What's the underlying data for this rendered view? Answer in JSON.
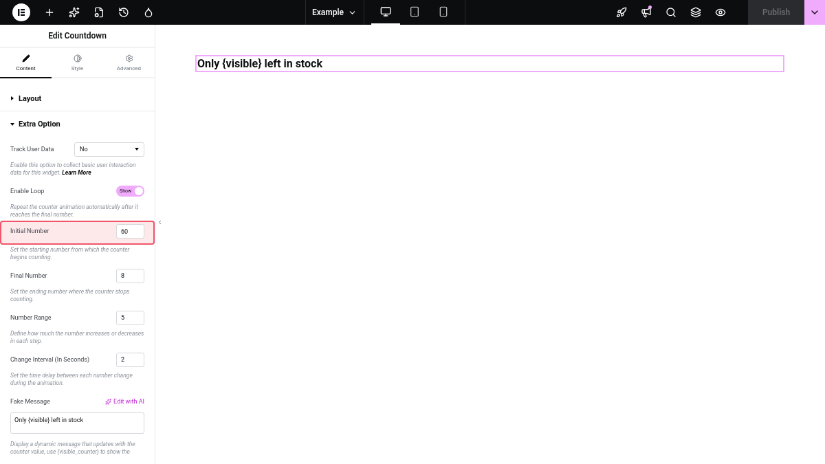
{
  "topbar": {
    "document": "Example",
    "devices": [
      {
        "kind": "desktop",
        "selected": true
      },
      {
        "kind": "tablet",
        "selected": false
      },
      {
        "kind": "mobile",
        "selected": false
      }
    ],
    "publish": {
      "label": "Publish",
      "disabled": true
    }
  },
  "panel": {
    "title": "Edit Countdown",
    "tabs": [
      {
        "label": "Content",
        "selected": true
      },
      {
        "label": "Style",
        "selected": false
      },
      {
        "label": "Advanced",
        "selected": false
      }
    ],
    "sections": [
      {
        "title": "Layout",
        "expanded": false
      },
      {
        "title": "Extra Option",
        "expanded": true
      }
    ],
    "controls": [
      {
        "kind": "select",
        "label": "Track User Data",
        "value": "No",
        "description": "Enable this option to collect basic user interaction data for this widget. **Learn More**",
        "highlighted": false
      },
      {
        "kind": "switch",
        "label": "Enable Loop",
        "on": true,
        "on_text": "Show",
        "description": "Repeat the counter animation automatically after it reaches the final number.",
        "highlighted": false
      },
      {
        "kind": "number",
        "label": "Initial Number",
        "value": "60",
        "description": "Set the starting number from which the counter begins counting.",
        "highlighted": true
      },
      {
        "kind": "number",
        "label": "Final Number",
        "value": "8",
        "description": "Set the ending number where the counter stops counting.",
        "highlighted": false
      },
      {
        "kind": "number",
        "label": "Number Range",
        "value": "5",
        "description": "Define how much the number increases or decreases in each step.",
        "highlighted": false
      },
      {
        "kind": "number",
        "label": "Change Interval (In Seconds)",
        "value": "2",
        "description": "Set the time delay between each number change during the animation.",
        "highlighted": false
      },
      {
        "kind": "textarea",
        "label": "Fake Message",
        "action": "Edit with AI",
        "value": "Only {visible} left in stock",
        "description": "Display a dynamic message that updates with the counter value, use {visible_counter} to show the",
        "highlighted": false
      }
    ]
  },
  "canvas": {
    "heading": "Only {visible} left in stock"
  }
}
